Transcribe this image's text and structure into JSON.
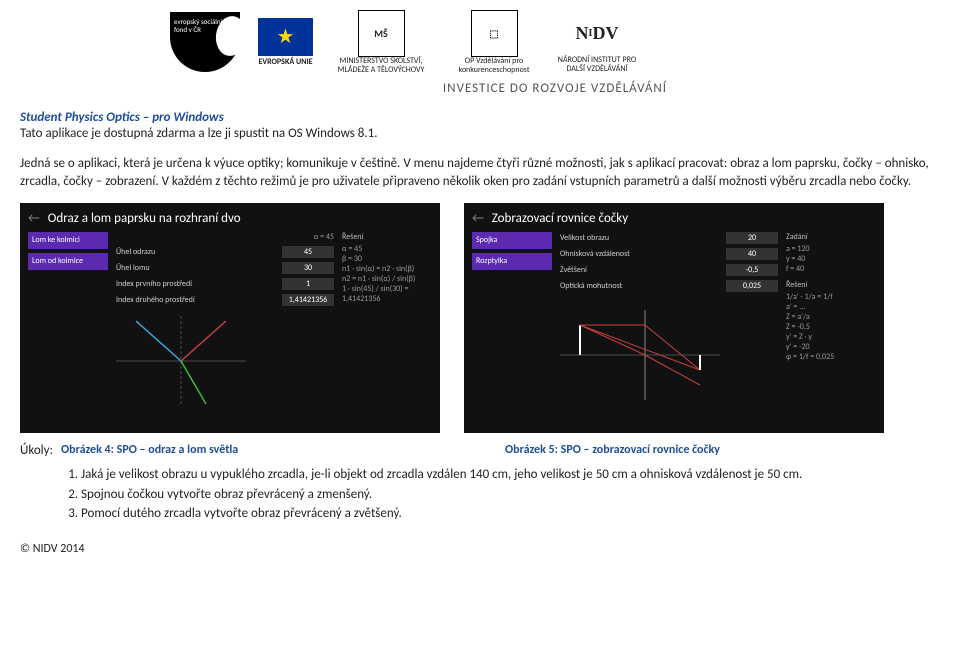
{
  "header": {
    "logos": {
      "esf": "evropský sociální fond v ČR",
      "eu": "EVROPSKÁ UNIE",
      "msmt": "MINISTERSTVO ŠKOLSTVÍ, MLÁDEŽE A TĚLOVÝCHOVY",
      "opvk": "OP Vzdělávání pro konkurenceschopnost",
      "nidv": "NÁRODNÍ INSTITUT PRO DALŠÍ VZDĚLÁVÁNÍ"
    },
    "invest": "INVESTICE DO ROZVOJE VZDĚLÁVÁNÍ"
  },
  "title": "Student Physics Optics – pro Windows",
  "intro": "Tato aplikace je dostupná zdarma a lze ji spustit na OS Windows 8.1.",
  "para": "Jedná se o aplikaci, která je určena k výuce optiky; komunikuje v češtině. V menu najdeme čtyři různé možnosti, jak s aplikací pracovat: obraz a lom paprsku, čočky – ohnisko, zrcadla, čočky – zobrazení. V každém z těchto režimů je pro uživatele připraveno několik oken pro zadání vstupních parametrů a další možnosti výběru zrcadla nebo čočky.",
  "shot1": {
    "title": "Odraz a lom paprsku na rozhraní dvo",
    "side1": "Lom ke kolmici",
    "side2": "Lom od kolmice",
    "l_uhel_odrazu": "Úhel odrazu",
    "v_uhel_odrazu": "45",
    "l_uhel_lomu": "Úhel lomu",
    "v_uhel_lomu": "30",
    "l_idx1": "Index prvního prostředí",
    "v_idx1": "1",
    "l_idx2": "Index druhého prostředí",
    "v_idx2": "1,41421356",
    "right_hdr": "Řešení",
    "right_lines": "α = 45\nβ = 30\nn1 · sin(α) = n2 · sin(β)\nn2 = n1 · sin(α) / sin(β)\n1 · sin(45) / sin(30) = 1,41421356",
    "top_a": "α = 45"
  },
  "shot2": {
    "title": "Zobrazovací rovnice čočky",
    "side1": "Spojka",
    "side2": "Rozptylka",
    "l_velikost": "Velikost obrazu",
    "v_velikost": "20",
    "l_ohnisko": "Ohnisková vzdálenost",
    "v_ohnisko": "40",
    "l_zvetseni": "Zvětšení",
    "v_zvetseni": "-0,5",
    "l_mohutnost": "Optická mohutnost",
    "v_mohutnost": "0,025",
    "right_hdr_zadani": "Zadání",
    "right_zadani": "a = 120\ny = 40\nf = 40",
    "right_hdr_reseni": "Řešení",
    "right_reseni": "1/a' - 1/a = 1/f\na' = ...\nZ = a'/a\nZ = -0,5\ny' = Z · y\ny' = -20\nφ = 1/f = 0,025"
  },
  "cap1": "Obrázek 4: SPO – odraz a lom světla",
  "cap2": "Obrázek 5: SPO – zobrazovací rovnice čočky",
  "ukoly_label": "Úkoly:",
  "tasks": [
    "Jaká je velikost obrazu u vypuklého zrcadla, je-li objekt od zrcadla vzdálen 140 cm, jeho velikost je 50 cm a ohnisková vzdálenost je 50 cm.",
    "Spojnou čočkou vytvořte obraz převrácený a zmenšený.",
    "Pomocí dutého zrcadla vytvořte obraz převrácený a zvětšený."
  ],
  "footer": "© NIDV 2014"
}
